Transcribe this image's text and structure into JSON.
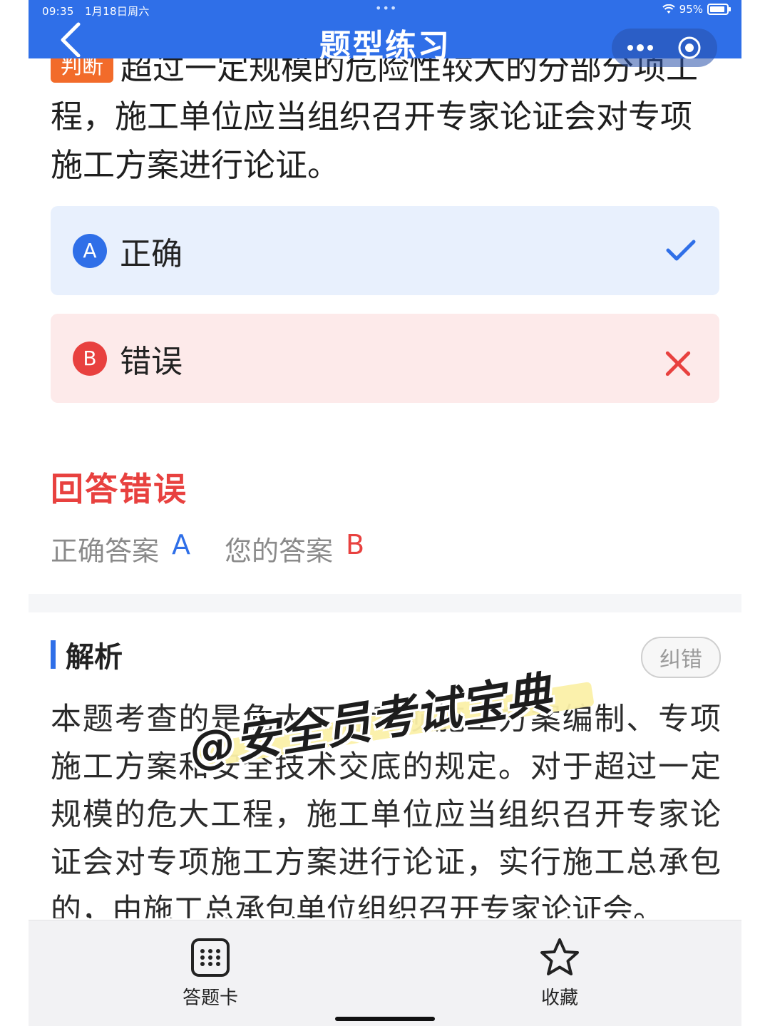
{
  "status_bar": {
    "time": "09:35",
    "date": "1月18日周六",
    "dots": "•••",
    "battery": "95%"
  },
  "nav": {
    "title": "题型练习",
    "back_icon": "chevron-left-icon",
    "more_icon": "more-dots-icon",
    "close_icon": "target-circle-icon"
  },
  "question": {
    "type_badge": "判断",
    "text": "超过一定规模的危险性较大的分部分项工程，施工单位应当组织召开专家论证会对专项施工方案进行论证。"
  },
  "options": [
    {
      "letter": "A",
      "text": "正确",
      "mark": "check-icon"
    },
    {
      "letter": "B",
      "text": "错误",
      "mark": "cross-icon"
    }
  ],
  "result": {
    "title": "回答错误",
    "correct_label": "正确答案",
    "correct_value": "A",
    "your_label": "您的答案",
    "your_value": "B"
  },
  "analysis": {
    "title": "解析",
    "report_button": "纠错",
    "text": "本题考查的是危大工程专项施工方案编制、专项施工方案和安全技术交底的规定。对于超过一定规模的危大工程，施工单位应当组织召开专家论证会对专项施工方案进行论证，实行施工总承包的，由施工总承包单位组织召开专家论证会。"
  },
  "watermark": {
    "text": "@安全员考试宝典"
  },
  "bottom_bar": {
    "items": [
      {
        "label": "答题卡",
        "icon": "answer-card-grid-icon"
      },
      {
        "label": "收藏",
        "icon": "star-icon"
      }
    ]
  },
  "colors": {
    "primary": "#2f6fe8",
    "error": "#e8413f",
    "badge": "#f26b2a",
    "option_a_bg": "#e8f0fd",
    "option_b_bg": "#fdeaea"
  }
}
